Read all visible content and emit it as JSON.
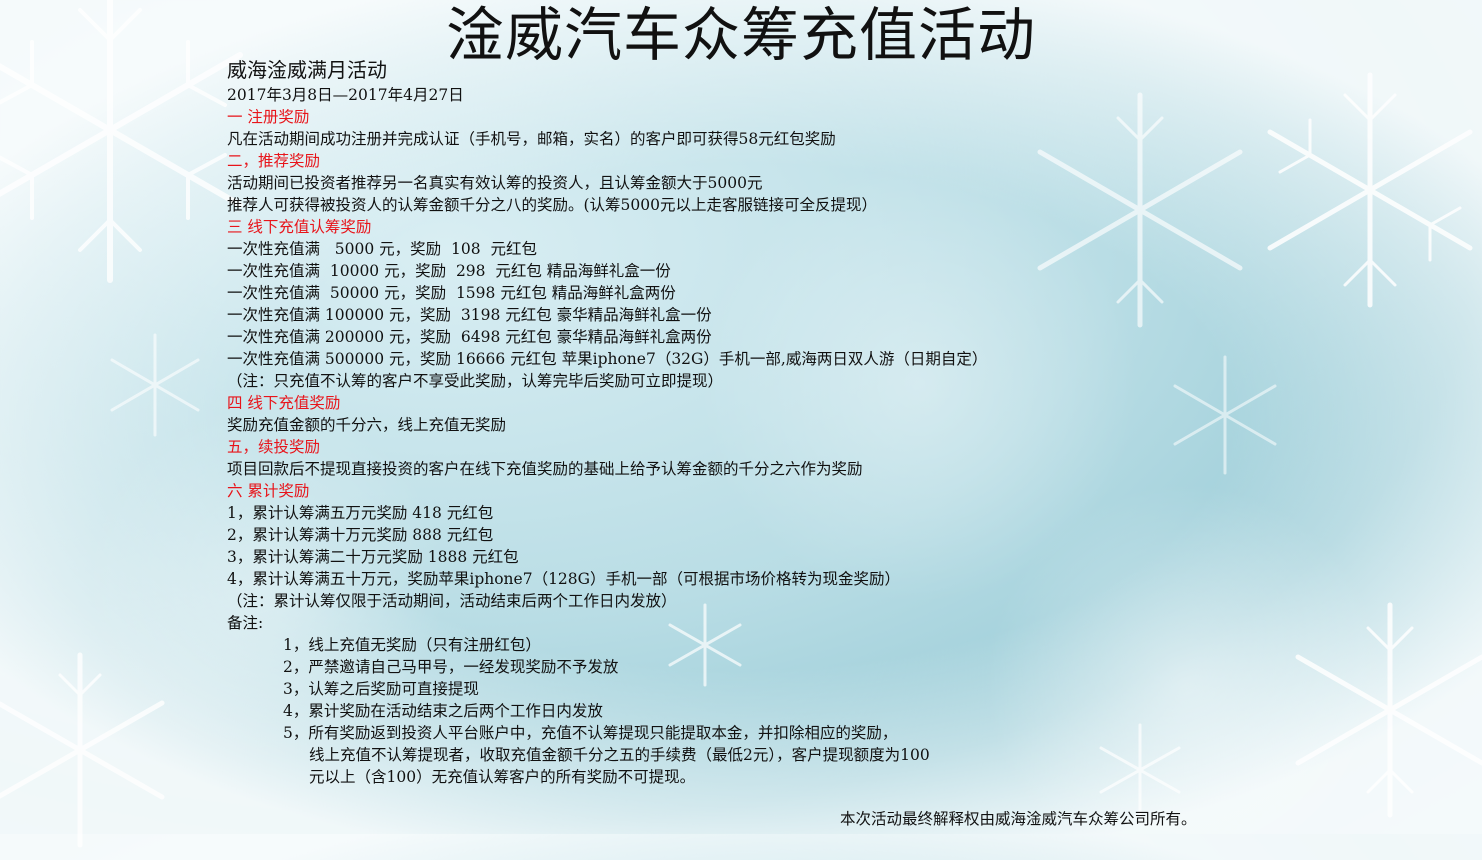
{
  "title": "淦威汽车众筹充值活动",
  "subtitle": "威海淦威满月活动",
  "date_range": "2017年3月8日—2017年4月27日",
  "sections": {
    "s1_heading": "一 注册奖励",
    "s1_text": "凡在活动期间成功注册并完成认证（手机号，邮箱，实名）的客户即可获得58元红包奖励",
    "s2_heading": "二，推荐奖励",
    "s2_text1": "活动期间已投资者推荐另一名真实有效认筹的投资人，且认筹金额大于5000元",
    "s2_text2": "推荐人可获得被投资人的认筹金额千分之八的奖励。(认筹5000元以上走客服链接可全反提现）",
    "s3_heading": "三 线下充值认筹奖励",
    "s3_rows": [
      "一次性充值满   5000 元，奖励  108  元红包",
      "一次性充值满  10000 元，奖励  298  元红包 精品海鲜礼盒一份",
      "一次性充值满  50000 元，奖励  1598 元红包 精品海鲜礼盒两份",
      "一次性充值满 100000 元，奖励  3198 元红包 豪华精品海鲜礼盒一份",
      "一次性充值满 200000 元，奖励  6498 元红包 豪华精品海鲜礼盒两份",
      "一次性充值满 500000 元，奖励 16666 元红包 苹果iphone7（32G）手机一部,威海两日双人游（日期自定）"
    ],
    "s3_note": "（注：只充值不认筹的客户不享受此奖励，认筹完毕后奖励可立即提现）",
    "s4_heading": "四 线下充值奖励",
    "s4_text": "奖励充值金额的千分六，线上充值无奖励",
    "s5_heading": "五，续投奖励",
    "s5_text": "项目回款后不提现直接投资的客户在线下充值奖励的基础上给予认筹金额的千分之六作为奖励",
    "s6_heading": "六 累计奖励",
    "s6_rows": [
      "1，累计认筹满五万元奖励 418 元红包",
      "2，累计认筹满十万元奖励 888 元红包",
      "3，累计认筹满二十万元奖励 1888 元红包",
      "4，累计认筹满五十万元，奖励苹果iphone7（128G）手机一部（可根据市场价格转为现金奖励）"
    ],
    "s6_note": "（注：累计认筹仅限于活动期间，活动结束后两个工作日内发放）",
    "remarks_label": "备注:",
    "remarks": [
      "1，线上充值无奖励（只有注册红包）",
      "2，严禁邀请自己马甲号，一经发现奖励不予发放",
      "3，认筹之后奖励可直接提现",
      "4，累计奖励在活动结束之后两个工作日内发放",
      "5，所有奖励返到投资人平台账户中，充值不认筹提现只能提取本金，并扣除相应的奖励，"
    ],
    "remark5_cont1": "线上充值不认筹提现者，收取充值金额千分之五的手续费（最低2元），客户提现额度为100",
    "remark5_cont2": "元以上（含100）无充值认筹客户的所有奖励不可提现。"
  },
  "footer": "本次活动最终解释权由威海淦威汽车众筹公司所有。",
  "colors": {
    "heading_red": "#e8141a",
    "text": "#111111",
    "bg_ice": "#a8d4de"
  }
}
